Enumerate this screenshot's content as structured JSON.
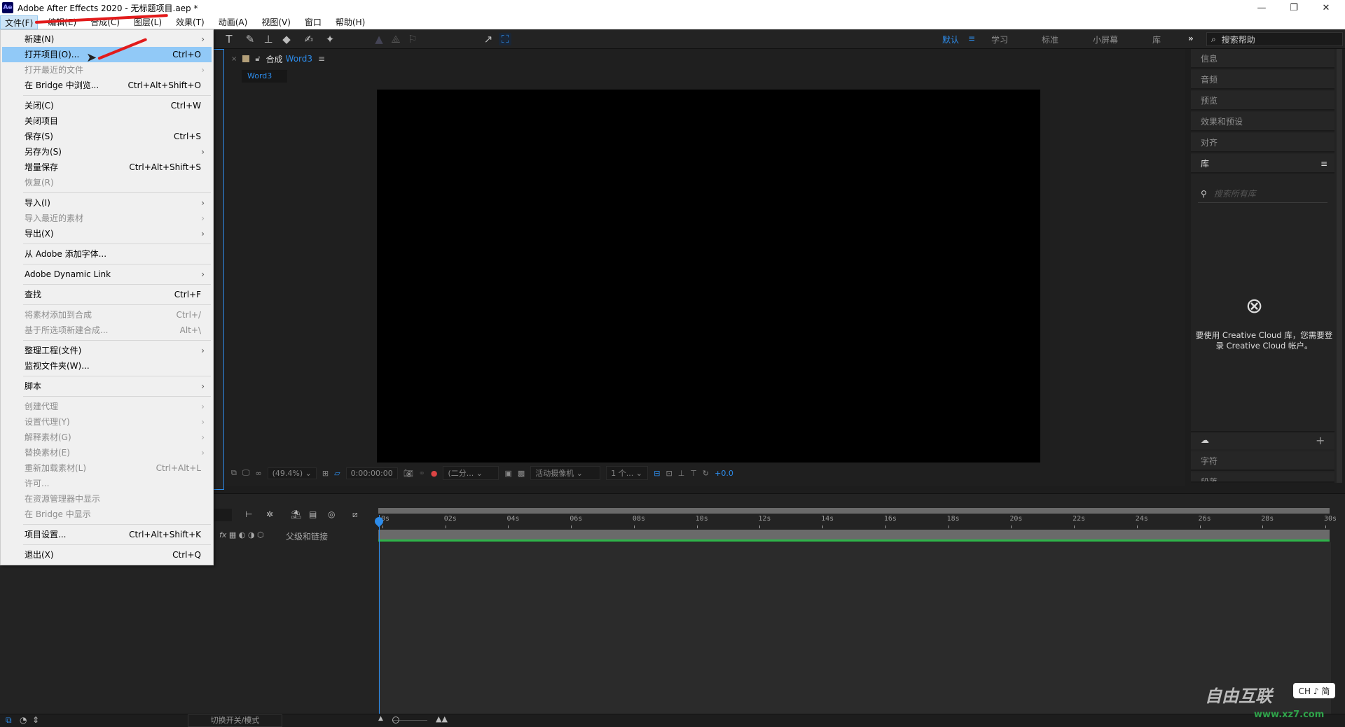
{
  "window": {
    "app_icon": "Ae",
    "title": "Adobe After Effects 2020 - 无标题项目.aep *",
    "minimize": "—",
    "restore": "❐",
    "close": "✕"
  },
  "menubar": [
    "文件(F)",
    "编辑(E)",
    "合成(C)",
    "图层(L)",
    "效果(T)",
    "动画(A)",
    "视图(V)",
    "窗口",
    "帮助(H)"
  ],
  "file_menu": {
    "items": [
      {
        "label": "新建(N)",
        "shortcut": "",
        "submenu": true,
        "disabled": false
      },
      {
        "label": "打开项目(O)...",
        "shortcut": "Ctrl+O",
        "submenu": false,
        "disabled": false,
        "highlighted": true
      },
      {
        "label": "打开最近的文件",
        "shortcut": "",
        "submenu": true,
        "disabled": true
      },
      {
        "label": "在 Bridge 中浏览...",
        "shortcut": "Ctrl+Alt+Shift+O",
        "submenu": false,
        "disabled": false
      },
      {
        "label": "关闭(C)",
        "shortcut": "Ctrl+W",
        "submenu": false,
        "disabled": false
      },
      {
        "label": "关闭项目",
        "shortcut": "",
        "submenu": false,
        "disabled": false
      },
      {
        "label": "保存(S)",
        "shortcut": "Ctrl+S",
        "submenu": false,
        "disabled": false
      },
      {
        "label": "另存为(S)",
        "shortcut": "",
        "submenu": true,
        "disabled": false
      },
      {
        "label": "增量保存",
        "shortcut": "Ctrl+Alt+Shift+S",
        "submenu": false,
        "disabled": false
      },
      {
        "label": "恢复(R)",
        "shortcut": "",
        "submenu": false,
        "disabled": true
      },
      {
        "label": "导入(I)",
        "shortcut": "",
        "submenu": true,
        "disabled": false
      },
      {
        "label": "导入最近的素材",
        "shortcut": "",
        "submenu": true,
        "disabled": true
      },
      {
        "label": "导出(X)",
        "shortcut": "",
        "submenu": true,
        "disabled": false
      },
      {
        "label": "从 Adobe 添加字体...",
        "shortcut": "",
        "submenu": false,
        "disabled": false
      },
      {
        "label": "Adobe Dynamic Link",
        "shortcut": "",
        "submenu": true,
        "disabled": false
      },
      {
        "label": "查找",
        "shortcut": "Ctrl+F",
        "submenu": false,
        "disabled": false
      },
      {
        "label": "将素材添加到合成",
        "shortcut": "Ctrl+/",
        "submenu": false,
        "disabled": true
      },
      {
        "label": "基于所选项新建合成...",
        "shortcut": "Alt+\\",
        "submenu": false,
        "disabled": true
      },
      {
        "label": "整理工程(文件)",
        "shortcut": "",
        "submenu": true,
        "disabled": false
      },
      {
        "label": "监视文件夹(W)...",
        "shortcut": "",
        "submenu": false,
        "disabled": false
      },
      {
        "label": "脚本",
        "shortcut": "",
        "submenu": true,
        "disabled": false
      },
      {
        "label": "创建代理",
        "shortcut": "",
        "submenu": true,
        "disabled": true
      },
      {
        "label": "设置代理(Y)",
        "shortcut": "",
        "submenu": true,
        "disabled": true
      },
      {
        "label": "解释素材(G)",
        "shortcut": "",
        "submenu": true,
        "disabled": true
      },
      {
        "label": "替换素材(E)",
        "shortcut": "",
        "submenu": true,
        "disabled": true
      },
      {
        "label": "重新加载素材(L)",
        "shortcut": "Ctrl+Alt+L",
        "submenu": false,
        "disabled": true
      },
      {
        "label": "许可...",
        "shortcut": "",
        "submenu": false,
        "disabled": true
      },
      {
        "label": "在资源管理器中显示",
        "shortcut": "",
        "submenu": false,
        "disabled": true
      },
      {
        "label": "在 Bridge 中显示",
        "shortcut": "",
        "submenu": false,
        "disabled": true
      },
      {
        "label": "项目设置...",
        "shortcut": "Ctrl+Alt+Shift+K",
        "submenu": false,
        "disabled": false
      },
      {
        "label": "退出(X)",
        "shortcut": "Ctrl+Q",
        "submenu": false,
        "disabled": false
      }
    ]
  },
  "toolbar": {
    "snap_label": "对齐",
    "workspaces": [
      "默认",
      "学习",
      "标准",
      "小屏幕",
      "库"
    ],
    "active_workspace": "默认",
    "more": "»",
    "help_search_placeholder": "搜索帮助"
  },
  "composition": {
    "panel_label": "合成",
    "comp_name": "Word3",
    "tab": "Word3",
    "zoom": "(49.4%)",
    "timecode": "0:00:00:00",
    "resolution": "(二分...",
    "camera": "活动摄像机",
    "views": "1 个...",
    "exposure": "+0.0"
  },
  "right_panel": {
    "items": [
      "信息",
      "音频",
      "预览",
      "效果和预设",
      "对齐"
    ],
    "library_title": "库",
    "library_search_placeholder": "搜索所有库",
    "cc_message": "要使用 Creative Cloud 库，您需要登录 Creative Cloud 帐户。",
    "bottom_items": [
      "字符",
      "段落"
    ]
  },
  "timeline": {
    "header_label": "父级和链接",
    "ticks": [
      "0s",
      "02s",
      "04s",
      "06s",
      "08s",
      "10s",
      "12s",
      "14s",
      "16s",
      "18s",
      "20s",
      "22s",
      "24s",
      "26s",
      "28s",
      "30s"
    ],
    "toggle_label": "切换开关/模式"
  },
  "overlay": {
    "ime": "CH ♪ 简",
    "watermark": "自由互联",
    "watermark_url": "www.xz7.com"
  }
}
